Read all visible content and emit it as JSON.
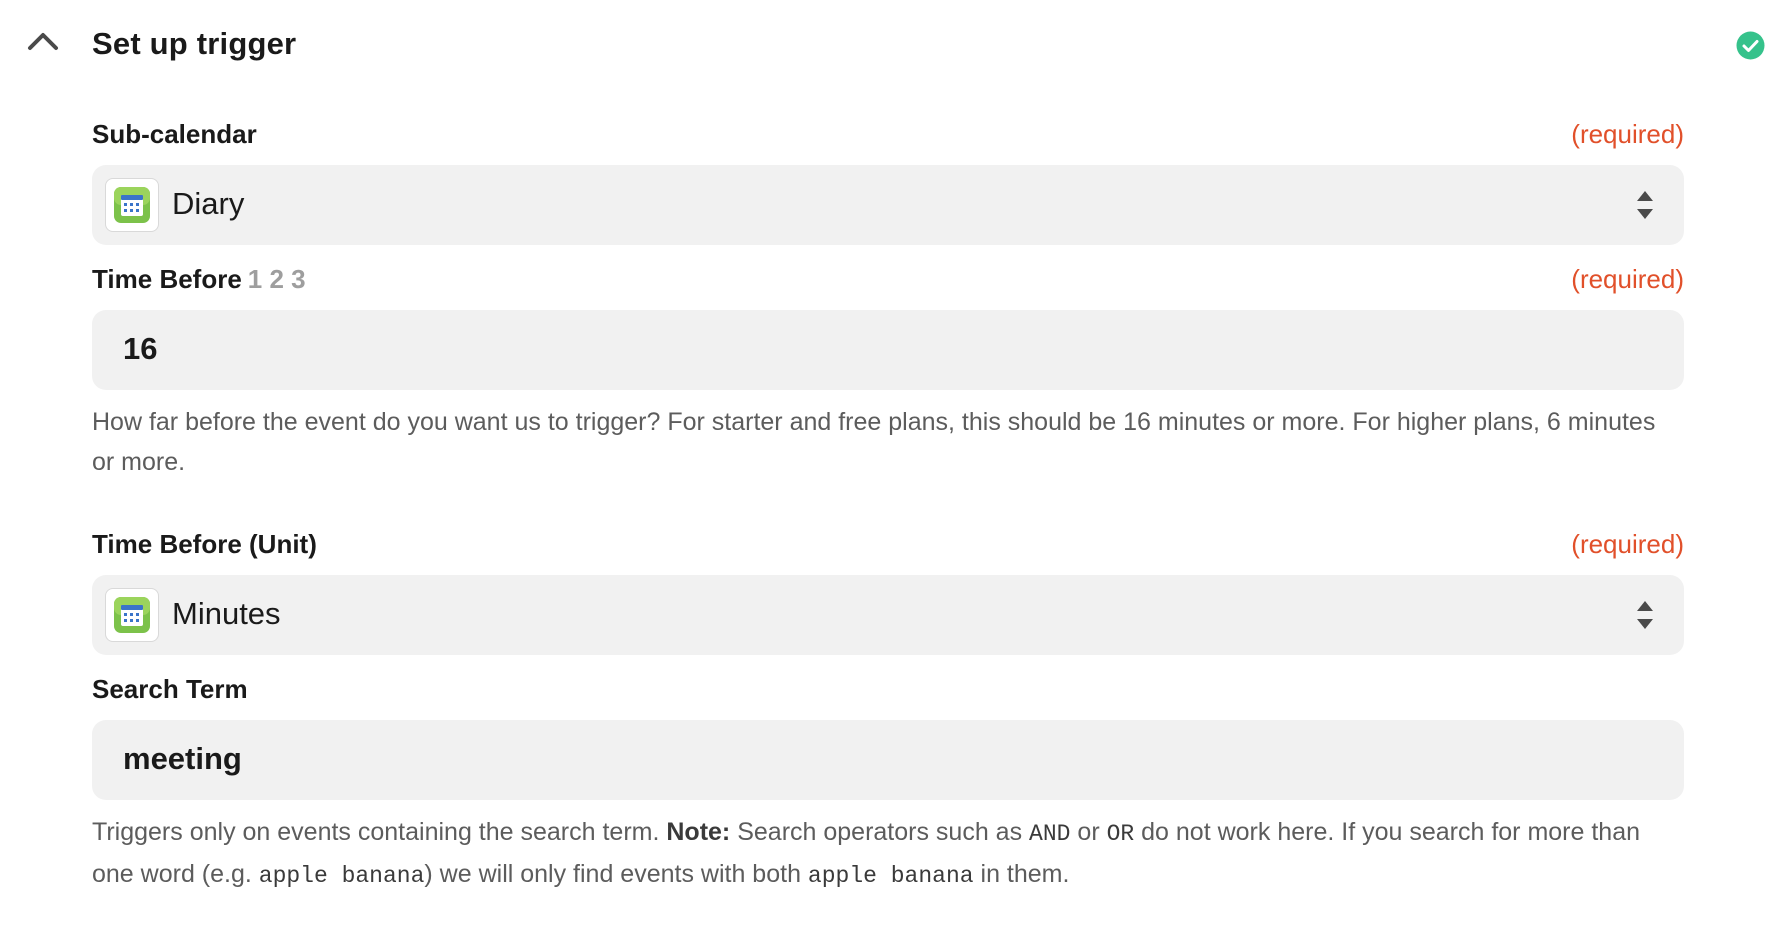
{
  "section": {
    "title": "Set up trigger",
    "collapse_icon": "chevron-up-icon",
    "status_icon": "check-circle-icon",
    "status_color": "#35c28b"
  },
  "fields": {
    "sub_calendar": {
      "label": "Sub-calendar",
      "required": "(required)",
      "value": "Diary",
      "app_icon": "teamup-calendar-icon"
    },
    "time_before": {
      "label": "Time Before",
      "step_numbers": "1 2 3",
      "required": "(required)",
      "value": "16",
      "help": "How far before the event do you want us to trigger? For starter and free plans, this should be 16 minutes or more. For higher plans, 6 minutes or more."
    },
    "time_before_unit": {
      "label": "Time Before (Unit)",
      "required": "(required)",
      "value": "Minutes",
      "app_icon": "teamup-calendar-icon"
    },
    "search_term": {
      "label": "Search Term",
      "value": "meeting",
      "help": {
        "intro": "Triggers only on events containing the search term. ",
        "note_label": "Note:",
        "part1": " Search operators such as ",
        "op_and": "AND",
        "part2": " or ",
        "op_or": "OR",
        "part3": " do not work here. If you search for more than one word (e.g. ",
        "example1": "apple banana",
        "part4": ") we will only find events with both ",
        "example2": "apple banana",
        "part5": " in them."
      }
    }
  },
  "colors": {
    "required": "#e1502a",
    "field_background": "#f1f1f1",
    "help_text": "#5c5c5c",
    "step_numbers": "#9e9e9e"
  }
}
